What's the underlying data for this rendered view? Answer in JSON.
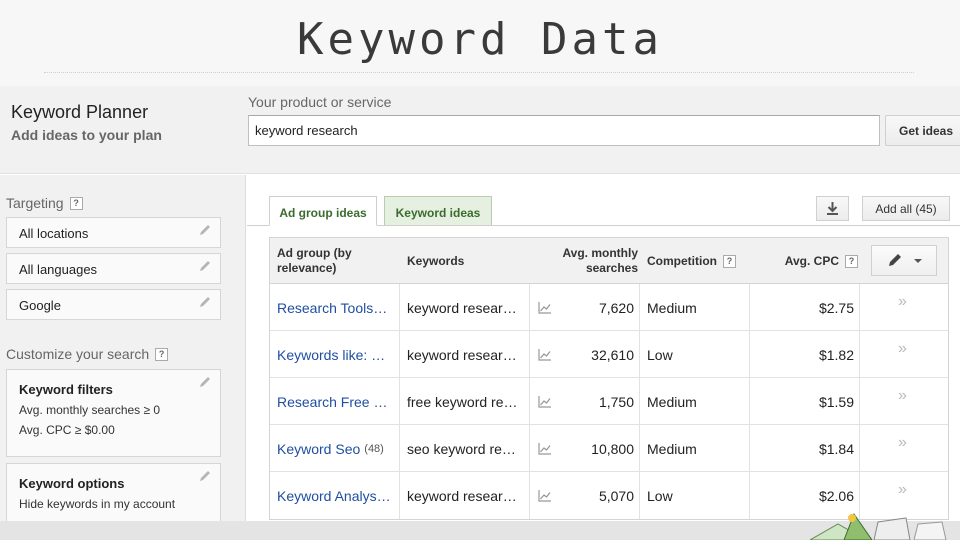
{
  "slide": {
    "title": "Keyword Data"
  },
  "header": {
    "title": "Keyword Planner",
    "subtitle": "Add ideas to your plan",
    "product_label": "Your product or service",
    "search_value": "keyword research",
    "get_ideas_label": "Get ideas"
  },
  "sidebar": {
    "targeting_label": "Targeting",
    "targeting_items": [
      "All locations",
      "All languages",
      "Google"
    ],
    "customize_label": "Customize your search",
    "keyword_filters": {
      "title": "Keyword filters",
      "lines": [
        "Avg. monthly searches ≥ 0",
        "Avg. CPC ≥ $0.00"
      ]
    },
    "keyword_options": {
      "title": "Keyword options",
      "lines": [
        "Hide keywords in my account"
      ]
    }
  },
  "main": {
    "tabs": [
      {
        "label": "Ad group ideas",
        "active": true
      },
      {
        "label": "Keyword ideas",
        "active": false
      }
    ],
    "add_all_label": "Add all (45)",
    "table": {
      "headers": {
        "ad_group": "Ad group (by relevance)",
        "keywords": "Keywords",
        "searches": "Avg. monthly searches",
        "competition": "Competition",
        "cpc": "Avg. CPC"
      },
      "rows": [
        {
          "ad_group": "Research Tools…",
          "count": "",
          "keywords": "keyword resear…",
          "searches": "7,620",
          "competition": "Medium",
          "cpc": "$2.75"
        },
        {
          "ad_group": "Keywords like: …",
          "count": "",
          "keywords": "keyword resear…",
          "searches": "32,610",
          "competition": "Low",
          "cpc": "$1.82"
        },
        {
          "ad_group": "Research Free …",
          "count": "",
          "keywords": "free keyword re…",
          "searches": "1,750",
          "competition": "Medium",
          "cpc": "$1.59"
        },
        {
          "ad_group": "Keyword Seo",
          "count": "(48)",
          "keywords": "seo keyword re…",
          "searches": "10,800",
          "competition": "Medium",
          "cpc": "$1.84"
        },
        {
          "ad_group": "Keyword Analys…",
          "count": "",
          "keywords": "keyword resear…",
          "searches": "5,070",
          "competition": "Low",
          "cpc": "$2.06"
        }
      ]
    }
  },
  "icons": {
    "help": "?",
    "pencil": "pencil-icon",
    "chevron": "»",
    "trend": "trend-chart-icon",
    "download": "download-icon"
  },
  "colors": {
    "link": "#1f4fa0",
    "tab_text": "#3b6b2e",
    "tab_inactive_bg": "#e6f0e0"
  }
}
